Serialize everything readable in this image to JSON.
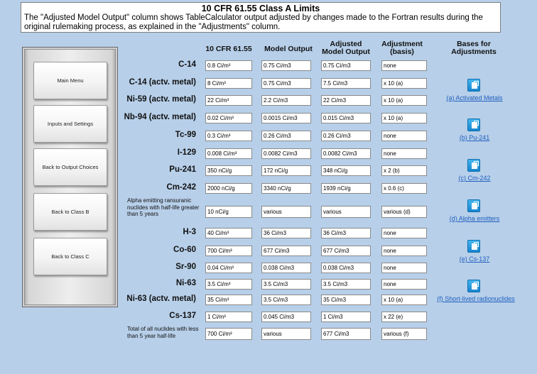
{
  "header": {
    "title": "10 CFR 61.55 Class A Limits",
    "description": "The \"Adjusted Model Output\" column shows TableCalculator output adjusted by changes made to the Fortran results during the original rulemaking process, as explained in the \"Adjustments\" column."
  },
  "nav": {
    "main_menu": "Main Menu",
    "inputs_settings": "Inputs and Settings",
    "back_output": "Back to Output Choices",
    "back_class_b": "Back to Class B",
    "back_class_c": "Back to Class C"
  },
  "columns": {
    "limits": "10 CFR 61.55",
    "model": "Model Output",
    "adjusted": "Adjusted Model Output",
    "adjustment": "Adjustment (basis)",
    "bases": "Bases for Adjustments"
  },
  "rows": [
    {
      "label": "C-14",
      "limit": "0.8 Ci/m³",
      "model": "0.75 Ci/m3",
      "adjusted": "0.75 Ci/m3",
      "adjustment": "none"
    },
    {
      "label": "C-14 (actv. metal)",
      "limit": "8 Ci/m³",
      "model": "0.75 Ci/m3",
      "adjusted": "7.5 Ci/m3",
      "adjustment": "x 10 (a)"
    },
    {
      "label": "Ni-59 (actv. metal)",
      "limit": "22 Ci/m³",
      "model": "2.2 Ci/m3",
      "adjusted": "22 Ci/m3",
      "adjustment": "x 10 (a)"
    },
    {
      "label": "Nb-94 (actv. metal)",
      "limit": "0.02 Ci/m³",
      "model": "0.0015 Ci/m3",
      "adjusted": "0.015 Ci/m3",
      "adjustment": "x 10 (a)"
    },
    {
      "label": "Tc-99",
      "limit": "0.3 Ci/m³",
      "model": "0.26 Ci/m3",
      "adjusted": "0.26 Ci/m3",
      "adjustment": "none"
    },
    {
      "label": "I-129",
      "limit": "0.008 Ci/m³",
      "model": "0.0082 Ci/m3",
      "adjusted": "0.0082 Ci/m3",
      "adjustment": "none"
    },
    {
      "label": "Pu-241",
      "limit": "350  nCi/g",
      "model": "172 nCi/g",
      "adjusted": "348 nCi/g",
      "adjustment": "x 2 (b)"
    },
    {
      "label": "Cm-242",
      "limit": "2000  nCi/g",
      "model": "3340 nCi/g",
      "adjusted": "1939 nCi/g",
      "adjustment": "x 0.6 (c)"
    },
    {
      "label": "Alpha emitting ransuranic nuclides with half-life greater than 5 years",
      "limit": "10 nCi/g",
      "model": "various",
      "adjusted": "various",
      "adjustment": "various (d)"
    },
    {
      "label": "H-3",
      "limit": "40 Ci/m³",
      "model": "36 Ci/m3",
      "adjusted": "36 Ci/m3",
      "adjustment": "none"
    },
    {
      "label": "Co-60",
      "limit": "700 Ci/m³",
      "model": "677 Ci/m3",
      "adjusted": "677 Ci/m3",
      "adjustment": "none"
    },
    {
      "label": "Sr-90",
      "limit": "0.04 Ci/m³",
      "model": "0.038 Ci/m3",
      "adjusted": "0.038 Ci/m3",
      "adjustment": "none"
    },
    {
      "label": "Ni-63",
      "limit": "3.5 Ci/m³",
      "model": "3.5 Ci/m3",
      "adjusted": "3.5 Ci/m3",
      "adjustment": "none"
    },
    {
      "label": "Ni-63 (actv. metal)",
      "limit": "35 Ci/m³",
      "model": "3.5 Ci/m3",
      "adjusted": "35 Ci/m3",
      "adjustment": "x 10 (a)"
    },
    {
      "label": "Cs-137",
      "limit": "1 Ci/m³",
      "model": "0.045 Ci/m3",
      "adjusted": "1 Ci/m3",
      "adjustment": "x 22 (e)"
    },
    {
      "label": "Total of all nuclides with less than 5 year half-life",
      "limit": "700 Ci/m³",
      "model": "various",
      "adjusted": "677 Ci/m3",
      "adjustment": "various (f)"
    }
  ],
  "bases_links": [
    "(a) Activated Metals",
    "(b) Pu-241",
    "(c) Cm-242",
    "(d) Alpha emitters",
    "(e) Cs-137",
    "(f) Short-lived radionuclides"
  ]
}
